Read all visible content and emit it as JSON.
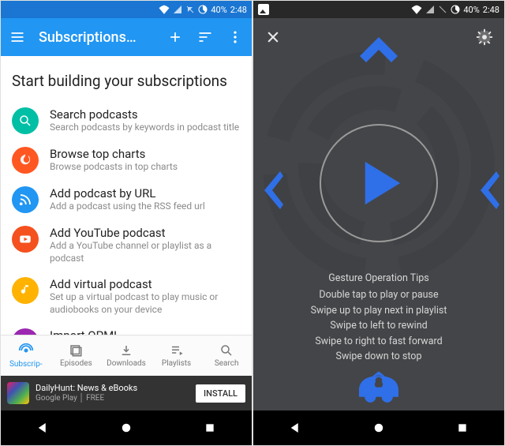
{
  "status": {
    "battery": "40%",
    "time": "2:48"
  },
  "left": {
    "appbar": {
      "title": "Subscriptions…"
    },
    "heading": "Start building your subscriptions",
    "items": [
      {
        "icon": "search",
        "color": "#00bfa5",
        "title": "Search podcasts",
        "sub": "Search podcasts by keywords in podcast title"
      },
      {
        "icon": "fire",
        "color": "#ff5722",
        "title": "Browse top charts",
        "sub": "Browse podcasts in top charts"
      },
      {
        "icon": "rss",
        "color": "#2196f3",
        "title": "Add podcast by URL",
        "sub": "Add a podcast using the RSS feed url"
      },
      {
        "icon": "youtube",
        "color": "#f4511e",
        "title": "Add YouTube podcast",
        "sub": "Add a YouTube channel or playlist as a podcast"
      },
      {
        "icon": "note",
        "color": "#ffb300",
        "title": "Add virtual podcast",
        "sub": "Set up a virtual podcast to play music or audiobooks on your device"
      },
      {
        "icon": "import",
        "color": "#9c27b0",
        "title": "Import OPML",
        "sub": ""
      }
    ],
    "bnav": [
      {
        "label": "Subscrip-",
        "active": true
      },
      {
        "label": "Episodes",
        "active": false
      },
      {
        "label": "Downloads",
        "active": false
      },
      {
        "label": "Playlists",
        "active": false
      },
      {
        "label": "Search",
        "active": false
      }
    ],
    "ad": {
      "title": "DailyHunt: News & eBooks",
      "sub": "Google Play │ FREE",
      "cta": "INSTALL"
    }
  },
  "right": {
    "tips_title": "Gesture Operation Tips",
    "tips": [
      "Double tap to play or pause",
      "Swipe up to play next in playlist",
      "Swipe to left to rewind",
      "Swipe to right to fast forward",
      "Swipe down to stop"
    ]
  }
}
